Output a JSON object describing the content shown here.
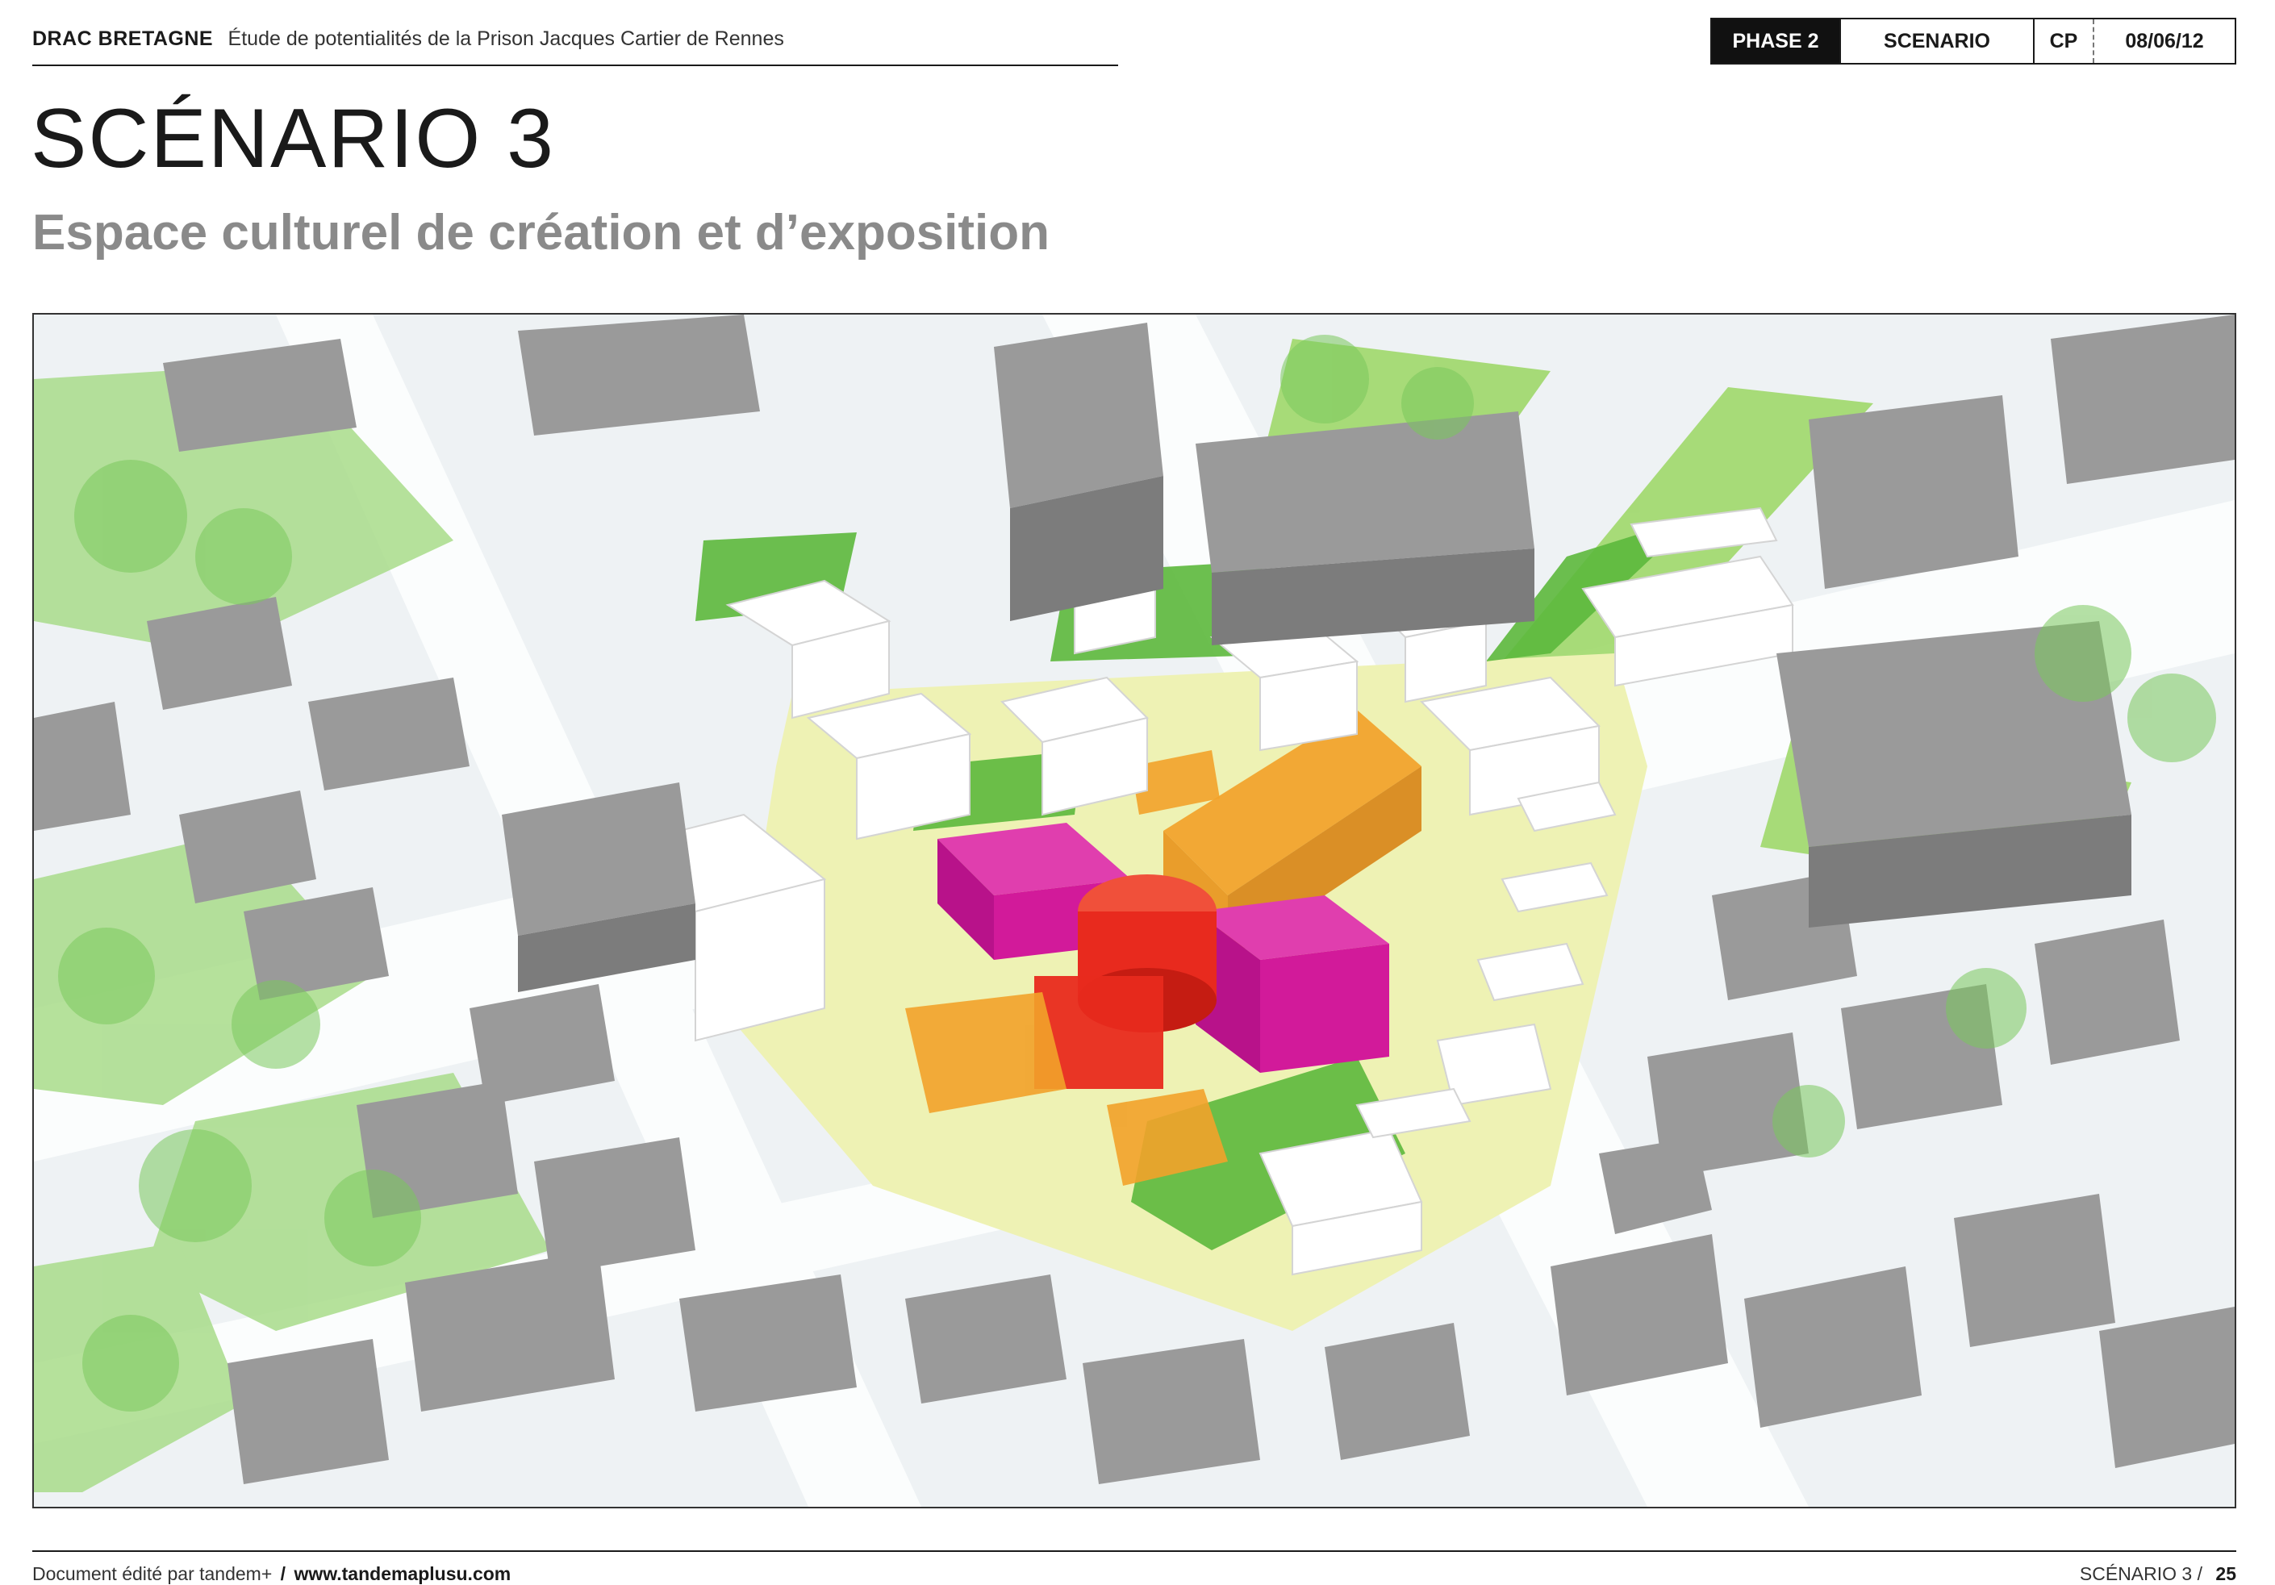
{
  "header": {
    "org": "DRAC BRETAGNE",
    "study": "Étude de potentialités de la Prison Jacques Cartier de Rennes",
    "tabs": {
      "phase": "PHASE 2",
      "scenario": "SCENARIO",
      "cp": "CP",
      "date": "08/06/12"
    }
  },
  "title": "SCÉNARIO 3",
  "subtitle": "Espace culturel de création et d’exposition",
  "footer": {
    "edited_by": "Document édité par tandem+",
    "separator": "/",
    "url": "www.tandemaplusu.com",
    "section": "SCÉNARIO 3 /",
    "page": "25"
  },
  "colors": {
    "magenta": "#d21a9a",
    "red": "#e82a1e",
    "orange": "#f2a22a",
    "green": "#5cb83c",
    "light_green": "#9fd86a",
    "pale_yellow": "#eef2b4",
    "building_grey": "#8e8e8e",
    "white_building": "#ffffff"
  }
}
